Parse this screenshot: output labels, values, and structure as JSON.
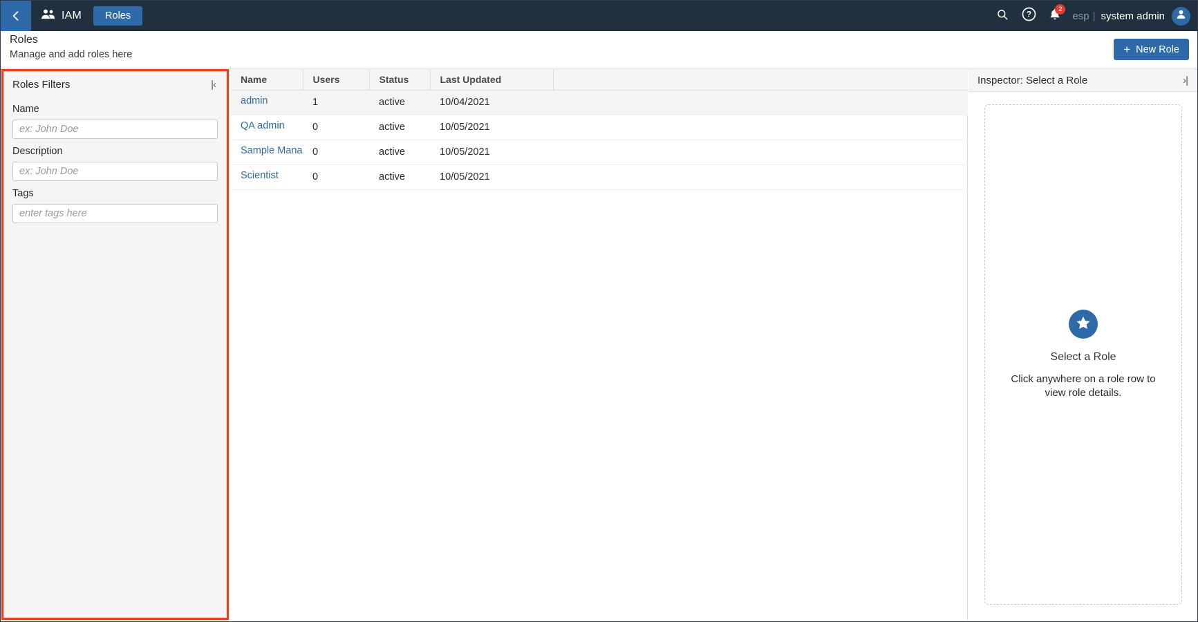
{
  "topnav": {
    "back_icon": "chevron-left-icon",
    "brand_icon": "people-icon",
    "brand_label": "IAM",
    "active_tab": "Roles",
    "search_icon": "search-icon",
    "help_icon": "help-icon",
    "bell_icon": "bell-icon",
    "notification_count": "2",
    "org_label": "esp",
    "separator": "|",
    "user_label": "system admin",
    "avatar_icon": "user-avatar-icon",
    "background_color": "#21303f",
    "accent_color": "#2f6aa8",
    "badge_color": "#e03c31"
  },
  "page": {
    "title": "Roles",
    "subtitle": "Manage and add roles here",
    "new_role_button": "New Role",
    "new_role_icon": "plus-icon"
  },
  "filters": {
    "title": "Roles Filters",
    "collapse_icon": "collapse-left-icon",
    "collapse_glyph": "|‹",
    "highlight_color": "#e8411c",
    "fields": [
      {
        "label": "Name",
        "value": "",
        "placeholder": "ex: John Doe"
      },
      {
        "label": "Description",
        "value": "",
        "placeholder": "ex: John Doe"
      },
      {
        "label": "Tags",
        "value": "",
        "placeholder": "enter tags here"
      }
    ]
  },
  "table": {
    "columns": [
      "Name",
      "Users",
      "Status",
      "Last Updated"
    ],
    "rows": [
      {
        "name": "admin",
        "users": "1",
        "status": "active",
        "updated": "10/04/2021",
        "selected": true
      },
      {
        "name": "QA admin",
        "users": "0",
        "status": "active",
        "updated": "10/05/2021",
        "selected": false
      },
      {
        "name": "Sample Manager",
        "users": "0",
        "status": "active",
        "updated": "10/05/2021",
        "selected": false
      },
      {
        "name": "Scientist",
        "users": "0",
        "status": "active",
        "updated": "10/05/2021",
        "selected": false
      }
    ]
  },
  "inspector": {
    "title": "Inspector: Select a Role",
    "expand_icon": "expand-right-icon",
    "expand_glyph": "›|",
    "star_icon": "star-icon",
    "heading": "Select a Role",
    "message": "Click anywhere on a role row to view role details."
  }
}
